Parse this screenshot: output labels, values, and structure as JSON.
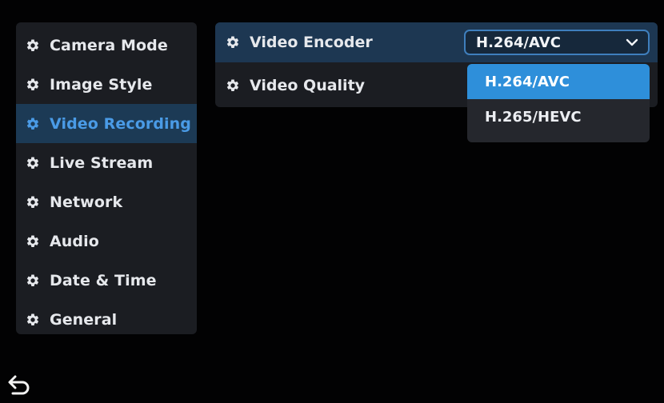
{
  "sidebar": {
    "items": [
      {
        "label": "Camera Mode",
        "icon": "gear-icon",
        "active": false
      },
      {
        "label": "Image Style",
        "icon": "gear-icon",
        "active": false
      },
      {
        "label": "Video Recording",
        "icon": "gear-icon",
        "active": true
      },
      {
        "label": "Live Stream",
        "icon": "gear-icon",
        "active": false
      },
      {
        "label": "Network",
        "icon": "gear-icon",
        "active": false
      },
      {
        "label": "Audio",
        "icon": "gear-icon",
        "active": false
      },
      {
        "label": "Date & Time",
        "icon": "gear-icon",
        "active": false
      },
      {
        "label": "General",
        "icon": "gear-icon",
        "active": false
      }
    ]
  },
  "settings": {
    "encoder": {
      "label": "Video Encoder",
      "value": "H.264/AVC"
    },
    "quality": {
      "label": "Video Quality"
    }
  },
  "dropdown": {
    "options": [
      {
        "label": "H.264/AVC",
        "selected": true
      },
      {
        "label": "H.265/HEVC",
        "selected": false
      }
    ]
  },
  "footer": {
    "back_icon": "back-arrow-icon"
  },
  "colors": {
    "background": "#020203",
    "panel": "#1b1d22",
    "active_bg": "#1c3a55",
    "active_text": "#4a9be6",
    "select_border": "#3f7fbd",
    "option_selected": "#2e8fda"
  }
}
